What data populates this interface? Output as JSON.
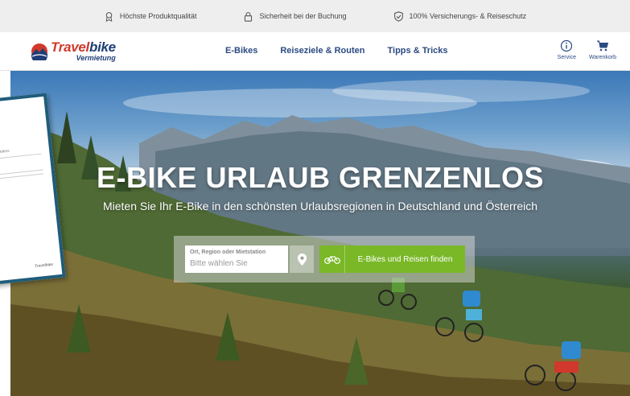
{
  "trustbar": {
    "items": [
      {
        "icon": "medal-icon",
        "label": "Höchste Produktqualität"
      },
      {
        "icon": "lock-icon",
        "label": "Sicherheit bei der Buchung"
      },
      {
        "icon": "shield-check-icon",
        "label": "100% Versicherungs- & Reiseschutz"
      }
    ]
  },
  "header": {
    "logo": {
      "part1": "Travel",
      "part2": "bike",
      "sub": "Vermietung"
    },
    "nav": [
      "E-Bikes",
      "Reiseziele & Routen",
      "Tipps & Tricks"
    ],
    "service_label": "Service",
    "cart_label": "Warenkorb"
  },
  "hero": {
    "title": "E-BIKE URLAUB GRENZENLOS",
    "subtitle": "Mieten Sie Ihr E-Bike in den schönsten Urlaubsregionen in Deutschland und Österreich",
    "search": {
      "label": "Ort, Region oder Mietstation",
      "placeholder": "Bitte wählen Sie"
    },
    "button_label": "E-Bikes und Reisen finden"
  },
  "brochure": {
    "heading": "Pedelecs",
    "footer": "Travelbike"
  },
  "colors": {
    "brand_red": "#d0392b",
    "brand_blue": "#1f3e77",
    "accent_green": "#7ab828"
  }
}
